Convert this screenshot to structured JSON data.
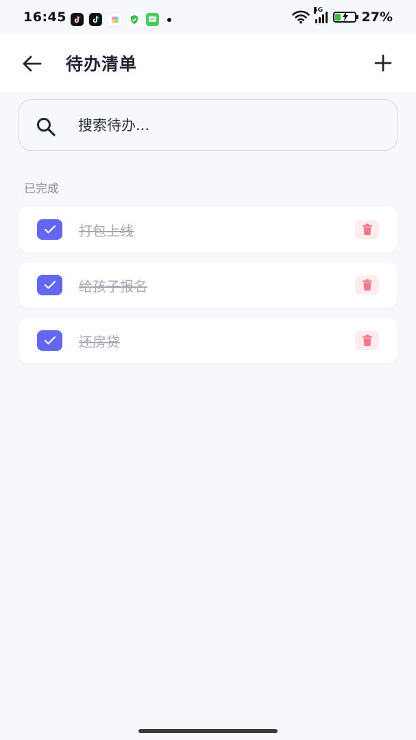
{
  "status_bar": {
    "time": "16:45",
    "network": "5G",
    "battery": "27%",
    "battery_level": 0.27,
    "apps": [
      {
        "icon": "tiktok-icon"
      },
      {
        "icon": "tiktok-icon"
      },
      {
        "icon": "flower-app-icon"
      },
      {
        "icon": "shield-app-icon"
      },
      {
        "icon": "message-app-icon"
      }
    ]
  },
  "header": {
    "title": "待办清单",
    "back_icon": "arrow-left-icon",
    "add_icon": "plus-icon"
  },
  "search": {
    "placeholder": "搜索待办...",
    "value": "",
    "icon": "search-icon"
  },
  "sections": {
    "completed": {
      "label": "已完成",
      "items": [
        {
          "text": "打包上线",
          "done": true
        },
        {
          "text": "给孩子报名",
          "done": true
        },
        {
          "text": "还房贷",
          "done": true
        }
      ]
    }
  },
  "colors": {
    "accent": "#6366f1",
    "delete_bg": "#fdecef",
    "delete_icon": "#f07a8c",
    "background": "#f7f8fb",
    "done_text": "#a4a8b2"
  }
}
